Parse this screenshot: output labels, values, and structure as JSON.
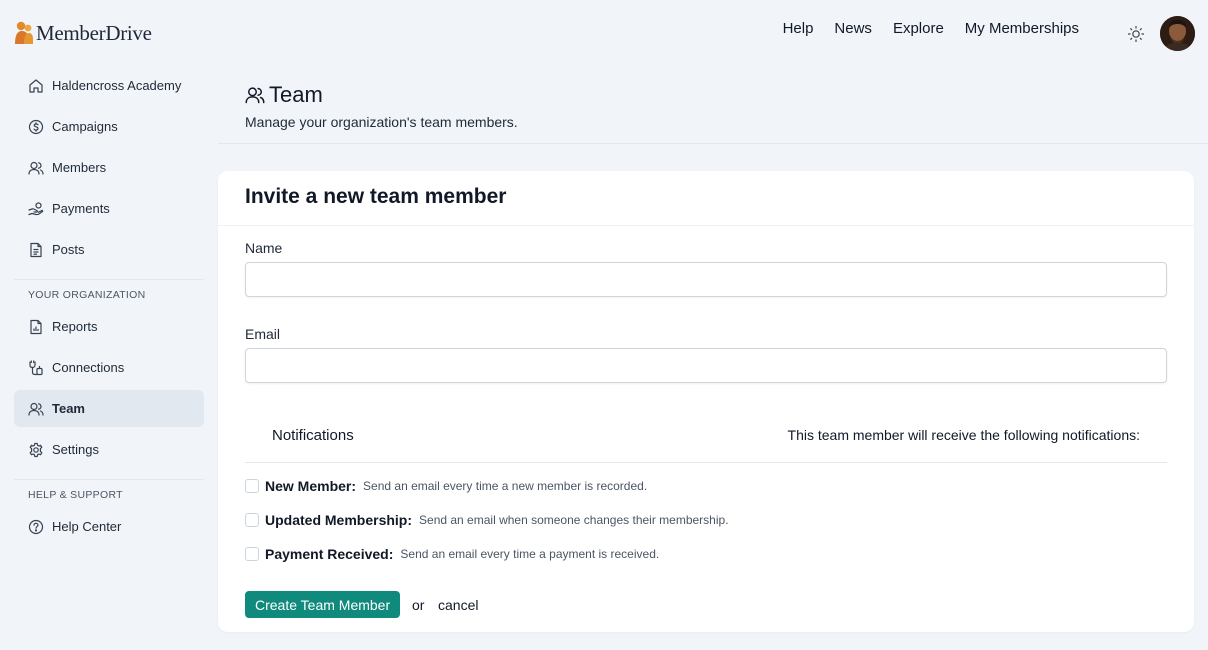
{
  "app": {
    "name": "MemberDrive"
  },
  "topnav": {
    "items": [
      "Help",
      "News",
      "Explore",
      "My Memberships"
    ]
  },
  "sidebar": {
    "items": [
      {
        "label": "Haldencross Academy",
        "icon": "home-icon"
      },
      {
        "label": "Campaigns",
        "icon": "dollar-circle-icon"
      },
      {
        "label": "Members",
        "icon": "users-icon"
      },
      {
        "label": "Payments",
        "icon": "hand-coins-icon"
      },
      {
        "label": "Posts",
        "icon": "document-icon"
      }
    ],
    "org_heading": "YOUR ORGANIZATION",
    "org_items": [
      {
        "label": "Reports",
        "icon": "report-chart-icon"
      },
      {
        "label": "Connections",
        "icon": "connection-icon"
      },
      {
        "label": "Team",
        "icon": "users-icon",
        "active": true
      },
      {
        "label": "Settings",
        "icon": "gear-icon"
      }
    ],
    "help_heading": "HELP & SUPPORT",
    "help_items": [
      {
        "label": "Help Center",
        "icon": "question-circle-icon"
      }
    ]
  },
  "page": {
    "title": "Team",
    "subtitle": "Manage your organization's team members."
  },
  "form": {
    "title": "Invite a new team member",
    "name_label": "Name",
    "name_value": "",
    "email_label": "Email",
    "email_value": "",
    "notifications_title": "Notifications",
    "notifications_desc": "This team member will receive the following notifications:",
    "options": [
      {
        "label": "New Member:",
        "help": "Send an email every time a new member is recorded.",
        "checked": false
      },
      {
        "label": "Updated Membership:",
        "help": "Send an email when someone changes their membership.",
        "checked": false
      },
      {
        "label": "Payment Received:",
        "help": "Send an email every time a payment is received.",
        "checked": false
      }
    ],
    "submit_label": "Create Team Member",
    "or_text": "or",
    "cancel_label": "cancel"
  },
  "colors": {
    "accent": "#0f8a7d",
    "background": "#f1f5f9",
    "active_item": "#e2e8f0"
  }
}
